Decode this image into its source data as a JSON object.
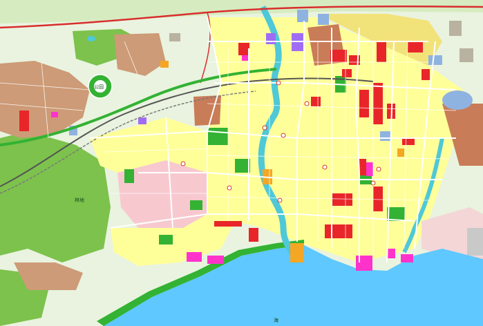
{
  "map": {
    "type": "urban-land-use-plan",
    "place_labels": [
      {
        "id": "park-north-west",
        "text": "公园"
      },
      {
        "id": "hill-forest",
        "text": "林地"
      },
      {
        "id": "sea-south",
        "text": "海"
      }
    ],
    "colors": {
      "background_green": "#e9f3df",
      "agricultural": "#c8e6a6",
      "residential": "#ffff99",
      "old_residential": "#f2e27a",
      "village": "#cd9b77",
      "commercial": "#e8262a",
      "education": "#f5a0c8",
      "industrial": "#c97c58",
      "public_service": "#ff66cc",
      "government": "#cc33ff",
      "green_space": "#33b233",
      "forest": "#88c85a",
      "water": "#4fc8d8",
      "sea": "#5ec8ff",
      "rail": "#7a7a7a",
      "highway": "#d92d2d",
      "road": "#ffffff",
      "pink_zone": "#f7c9cf",
      "warehouse": "#9ab",
      "blue_misc": "#8fb3e0",
      "orange": "#f5a623",
      "purple": "#9b59f5"
    }
  }
}
